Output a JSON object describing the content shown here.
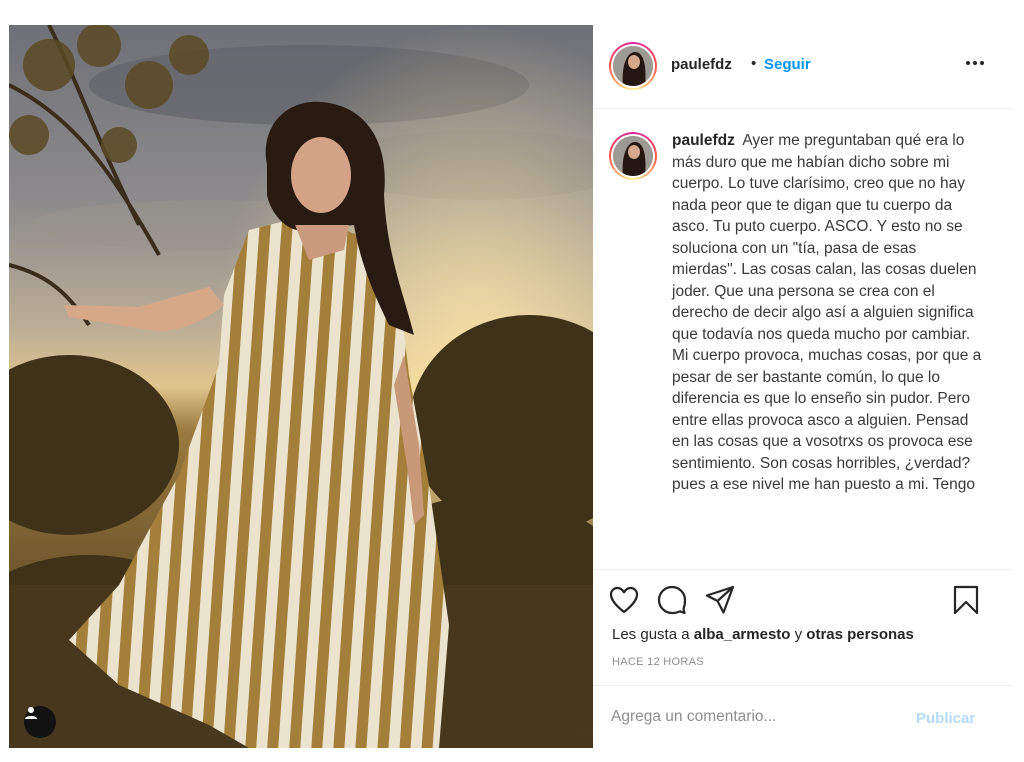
{
  "post": {
    "author": "paulefdz",
    "follow_label": "Seguir",
    "separator": "•",
    "caption_author": "paulefdz",
    "caption_text": "Ayer me preguntaban qué era lo más duro que me habían dicho sobre mi cuerpo. Lo tuve clarísimo, creo que no hay nada peor que te digan que tu cuerpo da asco. Tu puto cuerpo. ASCO. Y esto no se soluciona con un \"tía, pasa de esas mierdas\". Las cosas calan, las cosas duelen joder. Que una persona se crea con el derecho de decir algo así a alguien significa que todavía nos queda mucho por cambiar. Mi cuerpo provoca, muchas cosas, por que a pesar de ser bastante común, lo que lo diferencia es que lo enseño sin pudor. Pero entre ellas provoca asco a alguien. Pensad en las cosas que a vosotrxs os provoca ese sentimiento. Son cosas horribles, ¿verdad? pues a ese nivel me han puesto a mi. Tengo",
    "likes_prefix": "Les gusta a",
    "likes_user": "alba_armesto",
    "likes_joiner": "y",
    "likes_suffix": "otras personas",
    "timestamp": "HACE 12 HORAS",
    "comment_placeholder": "Agrega un comentario...",
    "publish_label": "Publicar"
  },
  "icons": {
    "options": "more-horizontal-icon",
    "like": "heart-icon",
    "comment": "comment-bubble-icon",
    "share": "paper-plane-icon",
    "save": "bookmark-icon",
    "tags": "person-icon"
  },
  "colors": {
    "link_blue": "#0095f6",
    "publish_disabled": "#b3dbff",
    "muted_text": "#8e8e8e",
    "divider": "#efefef"
  }
}
